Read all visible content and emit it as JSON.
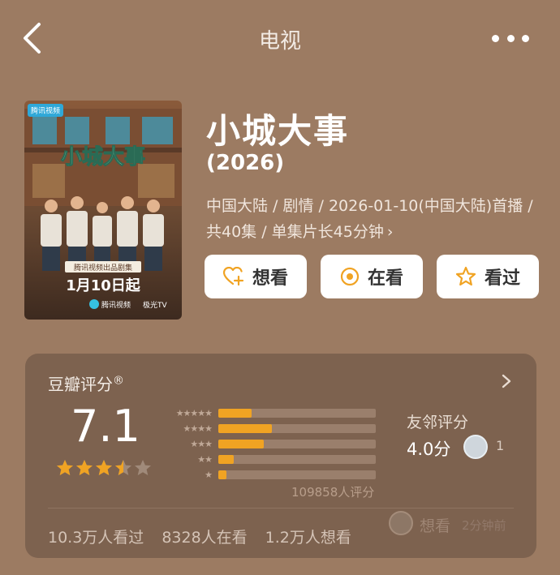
{
  "header": {
    "title": "电视",
    "back_icon": "chevron-left-icon",
    "more_icon": "more-horizontal-icon"
  },
  "poster": {
    "badge": "腾讯视频",
    "title_art": "小城大事",
    "tagline": "腾讯视频出品剧集",
    "date_text": "1月10日起",
    "platform_a": "腾讯视频",
    "platform_b": "极光TV"
  },
  "show": {
    "title": "小城大事",
    "year": "(2026)",
    "meta": "中国大陆 / 剧情 / 2026-01-10(中国大陆)首播 / 共40集 / 单集片长45分钟"
  },
  "actions": [
    {
      "label": "想看",
      "icon": "heart-plus-icon"
    },
    {
      "label": "在看",
      "icon": "target-circle-icon"
    },
    {
      "label": "看过",
      "icon": "star-outline-icon"
    }
  ],
  "rating": {
    "label": "豆瓣评分",
    "mark": "®",
    "score": "7.1",
    "stars_value": 3.5,
    "stars_max": 5,
    "distribution": [
      {
        "stars": "★★★★★",
        "fraction": 0.21
      },
      {
        "stars": "★★★★",
        "fraction": 0.34
      },
      {
        "stars": "★★★",
        "fraction": 0.29
      },
      {
        "stars": "★★",
        "fraction": 0.1
      },
      {
        "stars": "★",
        "fraction": 0.05
      }
    ],
    "count_text": "109858人评分",
    "friends_label": "友邻评分",
    "friends_score": "4.0分",
    "friends_count": "1",
    "star_color": "#f0a323"
  },
  "stats": {
    "watched": "10.3万人看过",
    "watching": "8328人在看",
    "want": "1.2万人想看"
  },
  "activity": {
    "action": "想看",
    "time": "2分钟前"
  }
}
